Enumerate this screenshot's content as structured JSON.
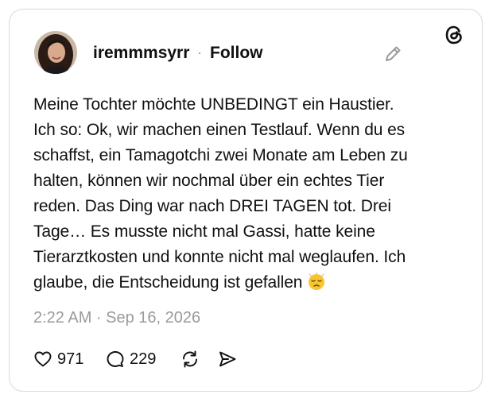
{
  "post": {
    "username": "iremmmsyrr",
    "separator": "·",
    "follow_label": "Follow",
    "text_lines": [
      "Meine Tochter möchte UNBEDINGT ein Haustier.",
      "Ich so: Ok, wir machen einen Testlauf. Wenn du es",
      "schaffst, ein Tamagotchi zwei Monate am Leben zu",
      "halten, können wir nochmal über ein echtes Tier",
      "reden. Das Ding war nach DREI TAGEN tot. Drei",
      "Tage… Es musste nicht mal Gassi, hatte keine",
      "Tierarztkosten und konnte nicht mal weglaufen. Ich",
      "glaube, die Entscheidung ist gefallen"
    ],
    "emoji": "sleepy-sad-face",
    "timestamp": "2:22 AM · Sep 16, 2026"
  },
  "actions": {
    "likes": "971",
    "replies": "229"
  },
  "icons": [
    "threads-logo-icon",
    "edit-pencil-icon",
    "heart-icon",
    "reply-bubble-icon",
    "repost-icon",
    "share-icon"
  ],
  "colors": {
    "text": "#101010",
    "muted": "#9a9a9a",
    "border": "#d9d9d9"
  }
}
